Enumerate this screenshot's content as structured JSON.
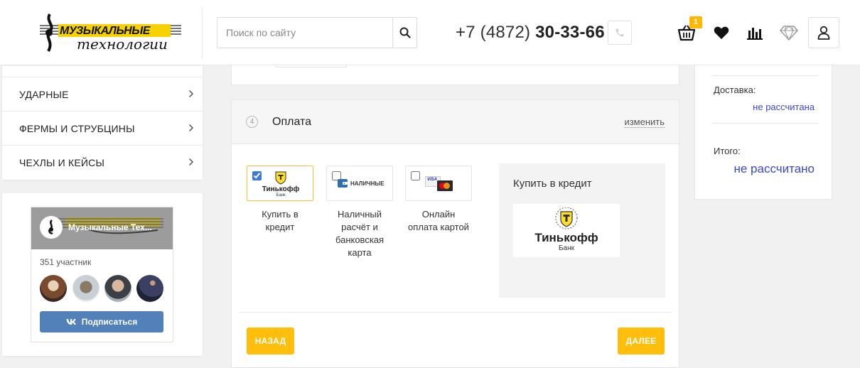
{
  "header": {
    "logo_line1": "МУЗЫКАЛЬНЫЕ",
    "logo_line2": "технологии",
    "search_placeholder": "Поиск по сайту",
    "phone_prefix": "+7 (4872)",
    "phone_number": "30-33-66",
    "cart_count": "1",
    "accent_color": "#ffb800"
  },
  "sidebar": {
    "menu": [
      {
        "label": "Ударные"
      },
      {
        "label": "Фермы и струбцины"
      },
      {
        "label": "Чехлы и кейсы"
      }
    ],
    "vk": {
      "group_title": "Музыкальные Тех...",
      "members": "351 участник",
      "subscribe_label": "Подписаться",
      "button_color": "#5181b8"
    }
  },
  "payment": {
    "step_number": "4",
    "title": "Оплата",
    "edit_label": "изменить",
    "options": [
      {
        "label_lines": [
          "Купить в",
          "кредит"
        ],
        "logo_text": "Тинькофф",
        "logo_sub": "Банк",
        "checked": true
      },
      {
        "label_lines": [
          "Наличный",
          "расчёт и",
          "банковская",
          "карта"
        ],
        "logo_text": "НАЛИЧНЫЕ",
        "checked": false
      },
      {
        "label_lines": [
          "Онлайн",
          "оплата картой"
        ],
        "logo_text": "VISA",
        "checked": false
      }
    ],
    "credit_panel_title": "Купить в кредит",
    "credit_logo_text": "Тинькофф",
    "credit_logo_sub": "Банк",
    "back_label": "НАЗАД",
    "next_label": "ДАЛЕЕ"
  },
  "summary": {
    "delivery_label": "Доставка:",
    "delivery_value": "не рассчитана",
    "total_label": "Итого:",
    "total_value": "не рассчитано",
    "value_color": "#3a47c8"
  }
}
